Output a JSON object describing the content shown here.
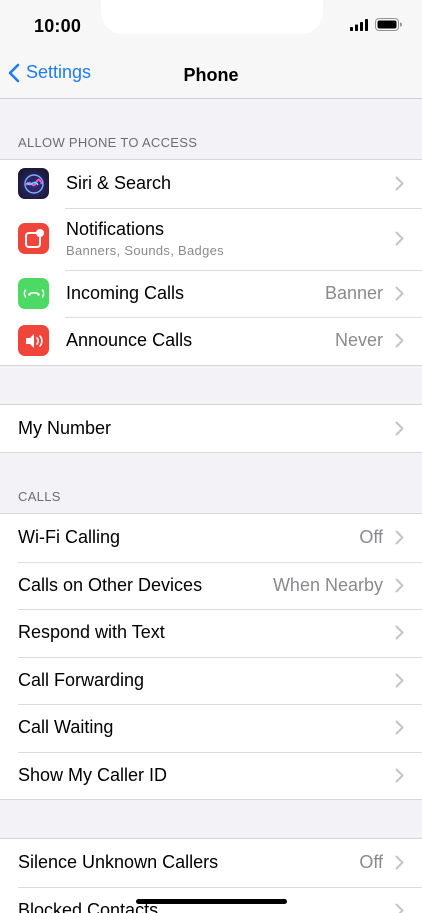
{
  "status": {
    "time": "10:00"
  },
  "nav": {
    "back_label": "Settings",
    "title": "Phone"
  },
  "section_access": {
    "header": "ALLOW PHONE TO ACCESS",
    "items": [
      {
        "label": "Siri & Search",
        "icon": "siri-icon",
        "color": "#2b2d8f"
      },
      {
        "label": "Notifications",
        "sublabel": "Banners, Sounds, Badges",
        "icon": "notifications-icon",
        "color": "#f0453a"
      },
      {
        "label": "Incoming Calls",
        "value": "Banner",
        "icon": "incoming-calls-icon",
        "color": "#4cd964"
      },
      {
        "label": "Announce Calls",
        "value": "Never",
        "icon": "announce-calls-icon",
        "color": "#f0453a"
      }
    ]
  },
  "my_number": {
    "label": "My Number"
  },
  "section_calls": {
    "header": "CALLS",
    "items": [
      {
        "label": "Wi-Fi Calling",
        "value": "Off"
      },
      {
        "label": "Calls on Other Devices",
        "value": "When Nearby"
      },
      {
        "label": "Respond with Text"
      },
      {
        "label": "Call Forwarding"
      },
      {
        "label": "Call Waiting"
      },
      {
        "label": "Show My Caller ID"
      }
    ]
  },
  "section_block": {
    "items": [
      {
        "label": "Silence Unknown Callers",
        "value": "Off"
      },
      {
        "label": "Blocked Contacts"
      }
    ]
  },
  "colors": {
    "accent": "#1f7bf1",
    "background": "#f2f2f7"
  }
}
